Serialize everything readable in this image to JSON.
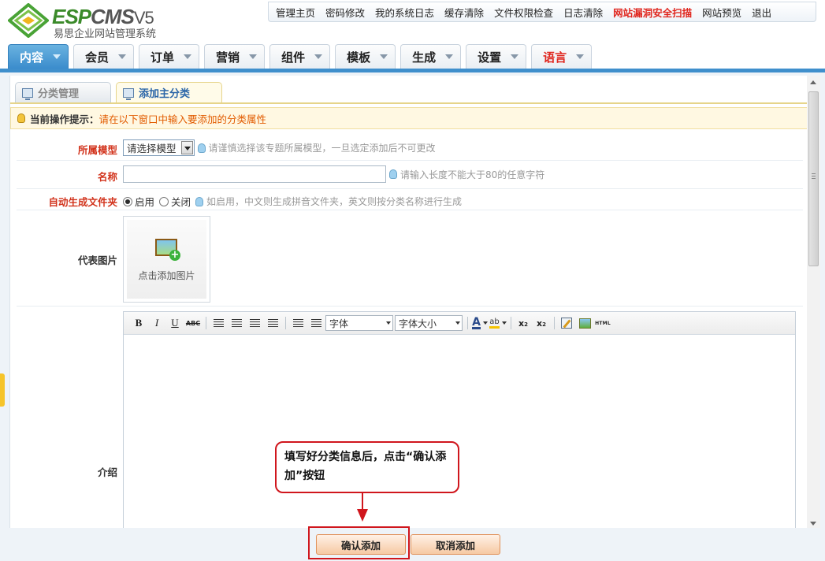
{
  "brand": {
    "logo_main": "ESP",
    "logo_cms": "CMS",
    "logo_version": "V5",
    "subtitle": "易思企业网站管理系统"
  },
  "topnav": {
    "items": [
      {
        "label": "管理主页"
      },
      {
        "label": "密码修改"
      },
      {
        "label": "我的系统日志"
      },
      {
        "label": "缓存清除"
      },
      {
        "label": "文件权限检查"
      },
      {
        "label": "日志清除"
      },
      {
        "label": "网站漏洞安全扫描"
      },
      {
        "label": "网站预览"
      },
      {
        "label": "退出"
      }
    ]
  },
  "mainnav": {
    "tabs": [
      {
        "label": "内容"
      },
      {
        "label": "会员"
      },
      {
        "label": "订单"
      },
      {
        "label": "营销"
      },
      {
        "label": "组件"
      },
      {
        "label": "模板"
      },
      {
        "label": "生成"
      },
      {
        "label": "设置"
      },
      {
        "label": "语言"
      }
    ]
  },
  "subtabs": {
    "items": [
      {
        "label": "分类管理"
      },
      {
        "label": "添加主分类"
      }
    ]
  },
  "tip": {
    "label": "当前操作提示：",
    "text": "请在以下窗口中输入要添加的分类属性"
  },
  "form": {
    "model": {
      "label": "所属模型",
      "value": "请选择模型",
      "hint": "请谨慎选择该专题所属模型，一旦选定添加后不可更改"
    },
    "name": {
      "label": "名称",
      "value": "",
      "hint": "请输入长度不能大于80的任意字符"
    },
    "auto_folder": {
      "label": "自动生成文件夹",
      "on_label": "启用",
      "off_label": "关闭",
      "selected": "启用",
      "hint": "如启用，中文则生成拼音文件夹，英文则按分类名称进行生成"
    },
    "image": {
      "label": "代表图片",
      "caption": "点击添加图片"
    },
    "intro": {
      "label": "介绍"
    }
  },
  "editor": {
    "font_label": "字体",
    "size_label": "字体大小",
    "html_label": "HTML"
  },
  "buttons": {
    "confirm": "确认添加",
    "cancel": "取消添加"
  },
  "annotation": {
    "text": "填写好分类信息后，点击“确认添加”按钮"
  },
  "colors": {
    "accent_blue": "#3f8fcc",
    "alert_red": "#e0271f",
    "annotation_red": "#d0161d",
    "tip_orange": "#e25b00"
  }
}
